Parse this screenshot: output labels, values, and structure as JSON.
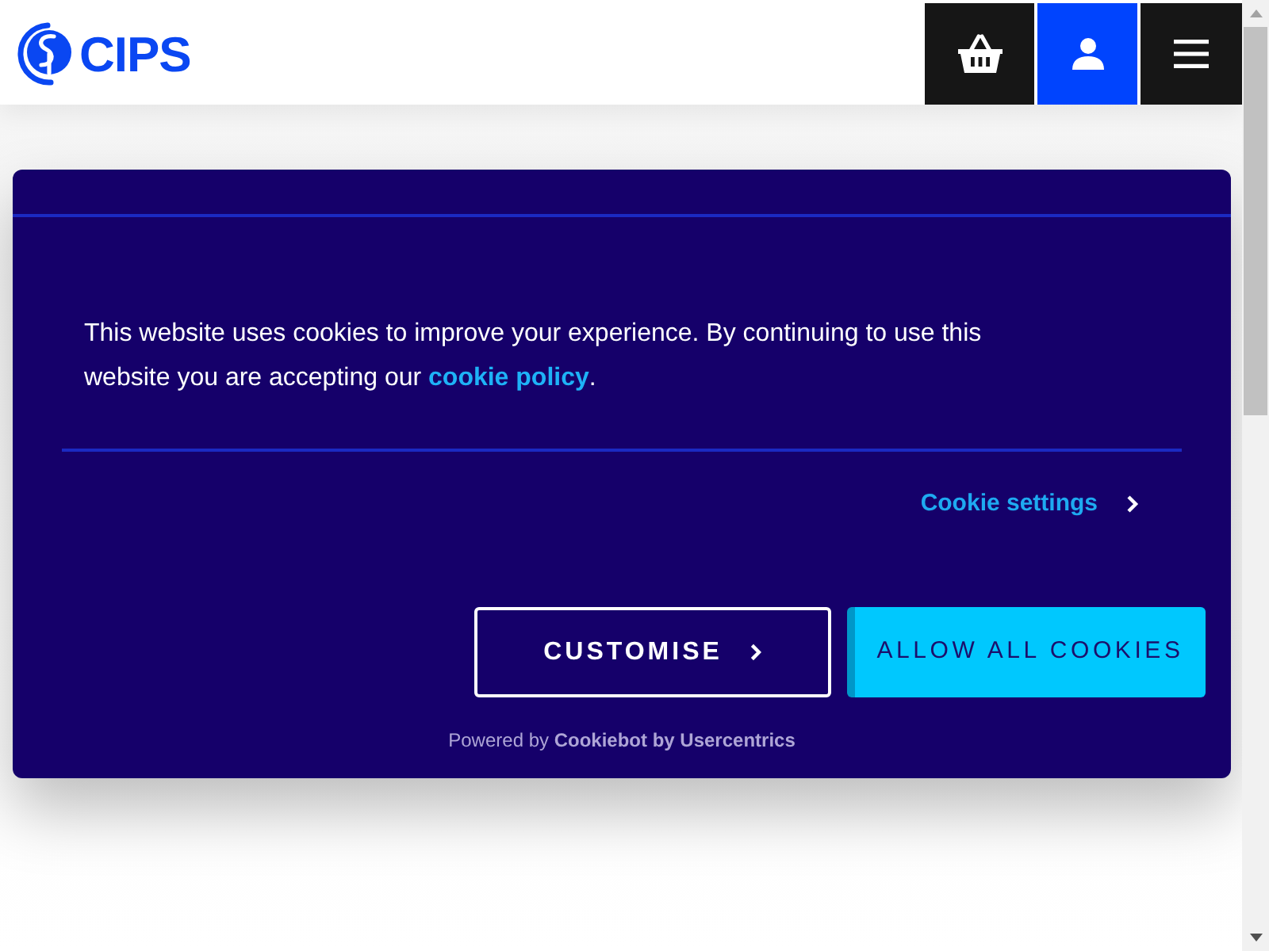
{
  "header": {
    "logo": "CIPS",
    "buttons": [
      {
        "kind": "basket"
      },
      {
        "kind": "account"
      },
      {
        "kind": "menu"
      }
    ]
  },
  "cookie_banner": {
    "message": {
      "before": "This website uses cookies to improve your experience. By continuing to use this website you are accepting our ",
      "link": "cookie policy",
      "after": "."
    },
    "settings_link": "Cookie settings",
    "buttons": [
      {
        "kind": "outline",
        "label": "CUSTOMISE"
      },
      {
        "kind": "primary",
        "label": "ALLOW ALL COOKIES"
      }
    ],
    "powered_by": "Powered by **Cookiebot by Usercentrics**"
  }
}
